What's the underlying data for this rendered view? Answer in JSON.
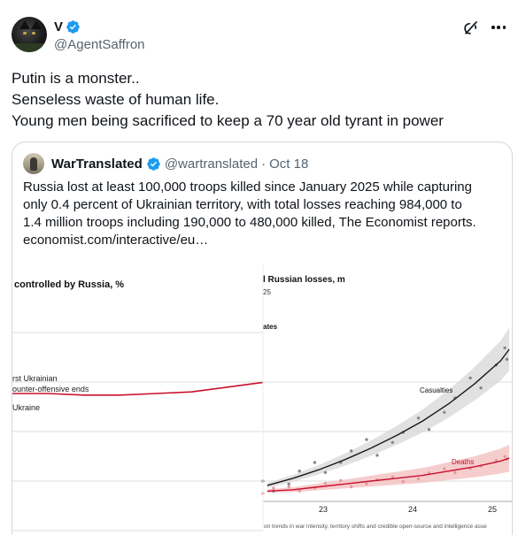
{
  "post": {
    "display_name": "V",
    "handle": "@AgentSaffron",
    "lines": [
      "Putin is a monster..",
      "Senseless waste of human life.",
      "Young men being sacrificed to keep a 70 year old tyrant in power"
    ]
  },
  "quote": {
    "display_name": "WarTranslated",
    "handle": "@wartranslated",
    "separator": "·",
    "date": "Oct 18",
    "lines": [
      "Russia lost at least 100,000 troops killed since January 2025 while capturing",
      "only 0.4 percent of Ukrainian territory, with total losses reaching 984,000 to",
      "1.4 million troops including 190,000 to 480,000 killed, The Economist reports.",
      "economist.com/interactive/eu…"
    ]
  },
  "media": {
    "left_chart": {
      "title": "controlled by Russia, %",
      "annotation_line1": "rst Ukrainian",
      "annotation_line2": "ounter-offensive ends",
      "label_ukraine": "Ukraine"
    },
    "right_chart": {
      "title": "l Russian losses, m",
      "subtitle": "25",
      "label_estimates": "ates",
      "label_casualties": "Casualties",
      "label_deaths": "Deaths",
      "x_ticks": [
        "23",
        "24",
        "25"
      ],
      "footnote": "on trends in war intensity, territory shifts and credible open-source and intelligence asse"
    },
    "colors": {
      "red": "#c8102e",
      "black": "#1a1a1a",
      "band_gray": "#d9d9d9",
      "band_red": "#f2b8b8"
    }
  },
  "chart_data": [
    {
      "type": "line",
      "title": "controlled by Russia, %",
      "series": [
        {
          "values": [
            18.2,
            18.2,
            18.1,
            18.1,
            18.2,
            18.3,
            18.6,
            18.9
          ]
        }
      ],
      "note": "cropped panel; values approximate, y-axis labels not visible"
    },
    {
      "type": "scatter",
      "title": "l Russian losses, m",
      "x": [
        22.4,
        22.7,
        23.0,
        23.3,
        23.6,
        23.9,
        24.2,
        24.5,
        24.8,
        25.1,
        25.2
      ],
      "series": [
        {
          "name": "Casualties",
          "values": [
            0.05,
            0.1,
            0.16,
            0.23,
            0.31,
            0.4,
            0.5,
            0.62,
            0.76,
            0.92,
            1.0
          ]
        },
        {
          "name": "Deaths",
          "values": [
            0.01,
            0.02,
            0.04,
            0.06,
            0.08,
            0.1,
            0.12,
            0.15,
            0.18,
            0.22,
            0.24
          ]
        }
      ],
      "xticks": [
        "23",
        "24",
        "25"
      ]
    }
  ]
}
